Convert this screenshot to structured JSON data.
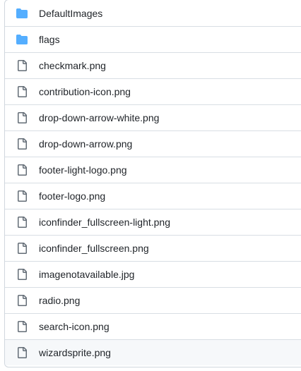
{
  "colors": {
    "folder": "#54aeff",
    "file_icon": "#636c76",
    "text": "#1f2328",
    "border": "#d0d7de",
    "hover_bg": "#f6f8fa"
  },
  "files": [
    {
      "name": "DefaultImages",
      "type": "folder",
      "icon": "folder-icon"
    },
    {
      "name": "flags",
      "type": "folder",
      "icon": "folder-icon"
    },
    {
      "name": "checkmark.png",
      "type": "file",
      "icon": "file-icon"
    },
    {
      "name": "contribution-icon.png",
      "type": "file",
      "icon": "file-icon"
    },
    {
      "name": "drop-down-arrow-white.png",
      "type": "file",
      "icon": "file-icon"
    },
    {
      "name": "drop-down-arrow.png",
      "type": "file",
      "icon": "file-icon"
    },
    {
      "name": "footer-light-logo.png",
      "type": "file",
      "icon": "file-icon"
    },
    {
      "name": "footer-logo.png",
      "type": "file",
      "icon": "file-icon"
    },
    {
      "name": "iconfinder_fullscreen-light.png",
      "type": "file",
      "icon": "file-icon"
    },
    {
      "name": "iconfinder_fullscreen.png",
      "type": "file",
      "icon": "file-icon"
    },
    {
      "name": "imagenotavailable.jpg",
      "type": "file",
      "icon": "file-icon"
    },
    {
      "name": "radio.png",
      "type": "file",
      "icon": "file-icon"
    },
    {
      "name": "search-icon.png",
      "type": "file",
      "icon": "file-icon"
    },
    {
      "name": "wizardsprite.png",
      "type": "file",
      "icon": "file-icon",
      "hovered": true
    }
  ]
}
